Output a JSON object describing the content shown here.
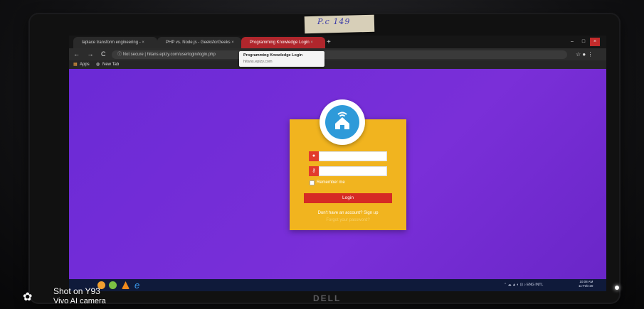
{
  "browser": {
    "tabs": [
      {
        "label": "laplace transform engineering -",
        "close": "×"
      },
      {
        "label": "PHP vs. Node.js - GeeksforGeeks",
        "close": "×"
      },
      {
        "label": "Programming Knowledge Login",
        "close": "×"
      }
    ],
    "new_tab": "+",
    "window_buttons": [
      "–",
      "□",
      "×"
    ],
    "nav": "← → C",
    "address": "ⓘ Not secure  |  hitans.epizy.com/userlogin/login.php",
    "address_right": "☆ ● ⋮",
    "bookmarks": [
      "Apps",
      "New Tab"
    ],
    "tooltip": {
      "title": "Programming Knowledge Login",
      "url": "hitans.epizy.com"
    }
  },
  "login": {
    "remember": "Remember me",
    "button": "Login",
    "signup": "Don't have an account? Sign up",
    "forgot": "Forgot your password?"
  },
  "taskbar": {
    "tray": "⌃ ☁ ▲ ◐ ⊡ ♪ ENG INTL",
    "clock_time": "10:08 AM",
    "clock_date": "11-Feb-20"
  },
  "sticker": {
    "text": "P.c 149"
  },
  "monitor": {
    "brand": "DELL"
  },
  "camera_watermark": {
    "line1": "Shot on Y93",
    "line2": "Vivo AI camera"
  },
  "colors": {
    "page_bg": "#6b2ad6",
    "card": "#f1b41f",
    "accent_red": "#d62a24",
    "logo_blue": "#2e9ad9"
  }
}
